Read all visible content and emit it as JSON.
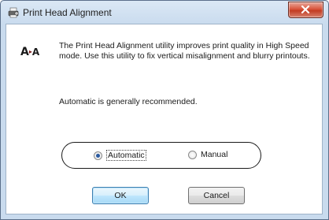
{
  "window": {
    "title": "Print Head Alignment"
  },
  "logo": {
    "big": "A",
    "arrow": "▸",
    "small": "A"
  },
  "description": "The Print Head Alignment utility improves print quality in High Speed mode. Use this utility to fix vertical misalignment and blurry printouts.",
  "recommendation": "Automatic is generally recommended.",
  "options": [
    {
      "label": "Automatic",
      "selected": true
    },
    {
      "label": "Manual",
      "selected": false
    }
  ],
  "buttons": {
    "ok": "OK",
    "cancel": "Cancel"
  },
  "colors": {
    "close_button": "#c23b22",
    "default_button_border": "#3c7fb1",
    "radio_dot": "#2a5aa0"
  }
}
